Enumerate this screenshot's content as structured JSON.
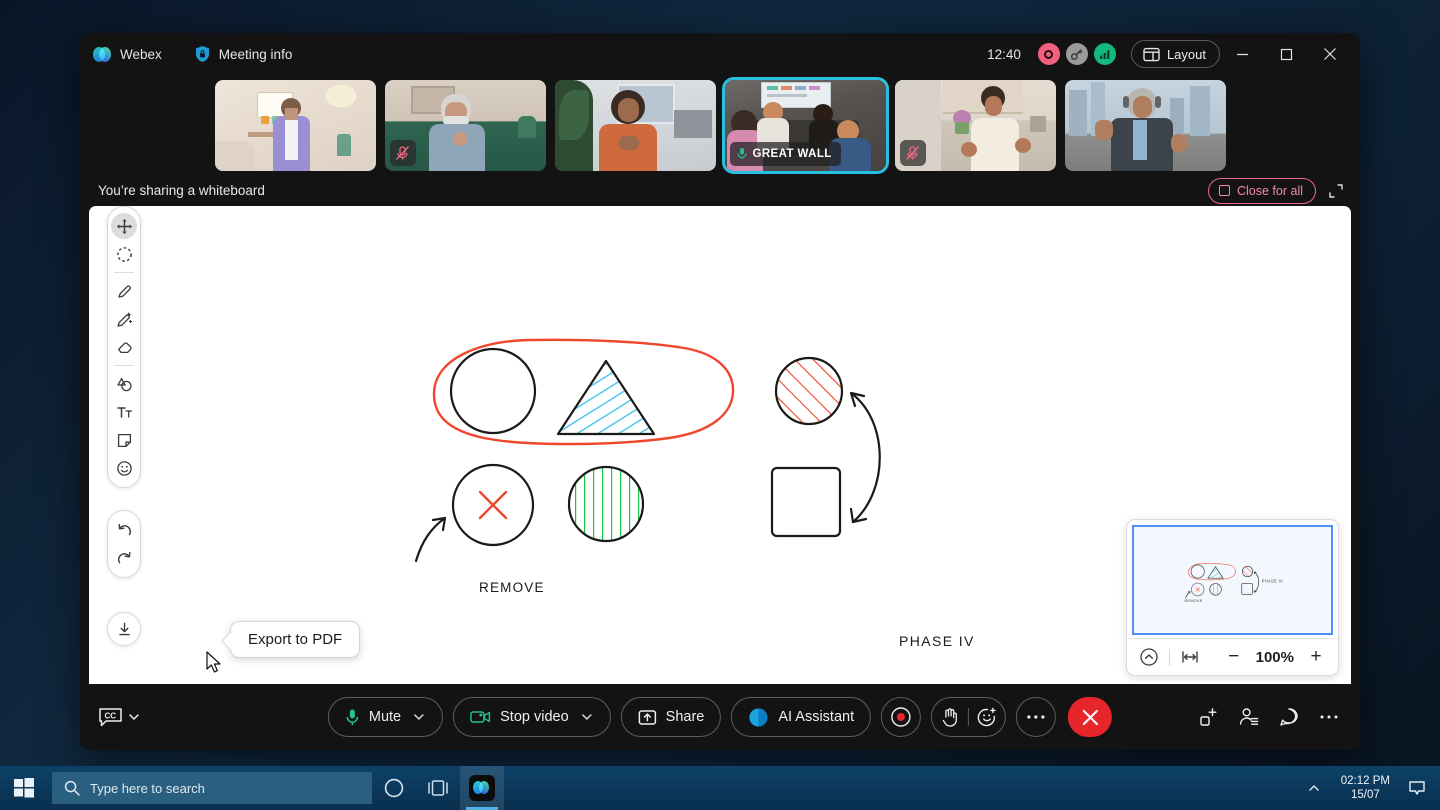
{
  "window": {
    "app_name": "Webex",
    "meeting_info_label": "Meeting info",
    "clock": "12:40",
    "layout_button": "Layout",
    "status_icons": [
      "record-indicator",
      "encryption-key",
      "network-signal"
    ],
    "window_controls": [
      "minimize",
      "maximize",
      "close"
    ]
  },
  "filmstrip": {
    "participants": [
      {
        "name": "",
        "muted": false,
        "active": false,
        "scene": "woman-purple-jacket-living-room"
      },
      {
        "name": "",
        "muted": true,
        "active": false,
        "scene": "older-man-green-sofa"
      },
      {
        "name": "",
        "muted": false,
        "active": false,
        "scene": "woman-orange-blouse-office"
      },
      {
        "name": "GREAT WALL",
        "muted": false,
        "active": true,
        "scene": "conference-room-four-people"
      },
      {
        "name": "",
        "muted": true,
        "active": false,
        "scene": "woman-white-blouse-kitchen"
      },
      {
        "name": "",
        "muted": false,
        "active": false,
        "scene": "man-headphones-city-rooftop"
      }
    ]
  },
  "share_bar": {
    "status_text": "You’re sharing a whiteboard",
    "close_for_all_label": "Close for all",
    "expand_icon": "expand-icon"
  },
  "whiteboard": {
    "tools": [
      {
        "name": "move-tool",
        "selected": true
      },
      {
        "name": "lasso-select-tool",
        "selected": false
      },
      {
        "name": "pen-tool",
        "selected": false
      },
      {
        "name": "smart-pen-tool",
        "selected": false
      },
      {
        "name": "eraser-tool",
        "selected": false
      },
      {
        "name": "shapes-tool",
        "selected": false
      },
      {
        "name": "text-tool",
        "selected": false
      },
      {
        "name": "sticky-note-tool",
        "selected": false
      },
      {
        "name": "emoji-tool",
        "selected": false
      }
    ],
    "history_tools": [
      {
        "name": "undo-button"
      },
      {
        "name": "redo-button"
      }
    ],
    "export_button": "export-to-pdf-button",
    "tooltip": "Export to PDF",
    "annotations": {
      "phase_label": "PHASE IV",
      "remove_label": "REMOVE"
    },
    "colors": {
      "ink": "#1a1a1a",
      "red": "#f0462d",
      "blue": "#29bde8",
      "green": "#16c447",
      "selection_outline": "#f0462d"
    },
    "shapes": [
      {
        "id": "circle-plain",
        "type": "circle",
        "fill": "none",
        "stroke": "#1a1a1a"
      },
      {
        "id": "triangle-blue-hatch",
        "type": "triangle",
        "fill": "blue-hatch",
        "stroke": "#1a1a1a"
      },
      {
        "id": "circle-red-hatch",
        "type": "circle",
        "fill": "red-diagonal-hatch",
        "stroke": "#1a1a1a"
      },
      {
        "id": "circle-with-x",
        "type": "circle",
        "fill": "red-x",
        "stroke": "#1a1a1a"
      },
      {
        "id": "circle-green-hatch",
        "type": "circle",
        "fill": "green-vertical-hatch",
        "stroke": "#1a1a1a"
      },
      {
        "id": "square-plain",
        "type": "square",
        "fill": "none",
        "stroke": "#1a1a1a"
      }
    ]
  },
  "minimap": {
    "collapse_icon": "collapse-chevron-icon",
    "fit_icon": "fit-to-width-icon",
    "zoom_out_label": "−",
    "zoom_level": "100%",
    "zoom_in_label": "+",
    "viewport_color": "#4f8ff7"
  },
  "controls": {
    "closed_captions": {
      "name": "closed-captions-button",
      "label": ""
    },
    "mute": {
      "label": "Mute",
      "has_dropdown": true,
      "icon": "microphone-icon",
      "icon_color": "#25c08a"
    },
    "video": {
      "label": "Stop video",
      "has_dropdown": true,
      "icon": "camera-icon",
      "icon_color": "#25c08a"
    },
    "share": {
      "label": "Share",
      "icon": "share-screen-icon"
    },
    "ai_assistant": {
      "label": "AI Assistant",
      "icon": "ai-assistant-icon"
    },
    "record": {
      "name": "record-button",
      "icon": "record-dot-icon",
      "icon_color": "#e6262b"
    },
    "reactions": {
      "raise_hand": "raise-hand-icon",
      "emoji": "emoji-reaction-icon"
    },
    "more": "more-options-button",
    "end_call": {
      "name": "end-call-button",
      "color": "#e6262b"
    },
    "right_icons": [
      {
        "name": "apps-button"
      },
      {
        "name": "participants-button"
      },
      {
        "name": "chat-button"
      },
      {
        "name": "more-right-button"
      }
    ]
  },
  "taskbar": {
    "start": "windows-start-button",
    "search_placeholder": "Type here to search",
    "cortana": "cortana-icon",
    "task_view": "task-view-icon",
    "pinned_app": "webex-taskbar-icon",
    "tray_chevron": "show-hidden-icons",
    "clock_time": "02:12 PM",
    "clock_date": "15/07",
    "notifications": "notifications-icon"
  }
}
